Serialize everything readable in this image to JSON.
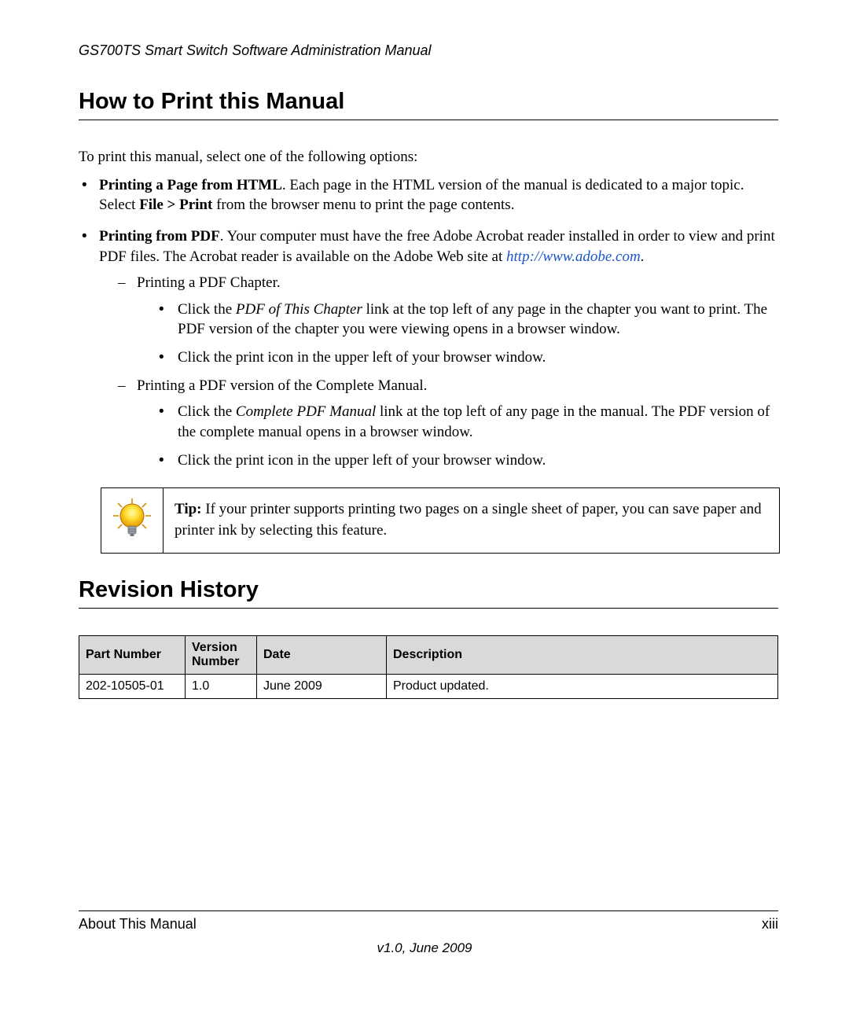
{
  "header": "GS700TS Smart Switch Software Administration Manual",
  "section1": {
    "heading": "How to Print this Manual",
    "intro": "To print this manual, select one of the following options:",
    "b1_bold": "Printing a Page from HTML",
    "b1_rest_a": ". Each page in the HTML version of the manual is dedicated to a major topic. Select ",
    "b1_bold2": "File > Print",
    "b1_rest_b": " from the browser menu to print the page contents.",
    "b2_bold": "Printing from PDF",
    "b2_rest": ". Your computer must have the free Adobe Acrobat reader installed in order to view and print PDF files. The Acrobat reader is available on the Adobe Web site at ",
    "b2_link": "http://www.adobe.com",
    "b2_period": ".",
    "d1": "Printing a PDF Chapter.",
    "d1_s1_a": "Click the ",
    "d1_s1_i": "PDF of This Chapter",
    "d1_s1_b": " link at the top left of any page in the chapter you want to print. The PDF version of the chapter you were viewing opens in a browser window.",
    "d1_s2": "Click the print icon in the upper left of your browser window.",
    "d2": "Printing a PDF version of the Complete Manual.",
    "d2_s1_a": "Click the ",
    "d2_s1_i": "Complete PDF Manual",
    "d2_s1_b": " link at the top left of any page in the manual. The PDF version of the complete manual opens in a browser window.",
    "d2_s2": "Click the print icon in the upper left of your browser window."
  },
  "tip": {
    "label": "Tip:",
    "text": " If your printer supports printing two pages on a single sheet of paper, you can save paper and printer ink by selecting this feature."
  },
  "section2": {
    "heading": "Revision History",
    "th1": "Part Number",
    "th2": "Version Number",
    "th3": "Date",
    "th4": "Description",
    "r1c1": "202-10505-01",
    "r1c2": "1.0",
    "r1c3": "June 2009",
    "r1c4": "Product updated."
  },
  "footer": {
    "left": "About This Manual",
    "right": "xiii",
    "version": "v1.0, June 2009"
  }
}
